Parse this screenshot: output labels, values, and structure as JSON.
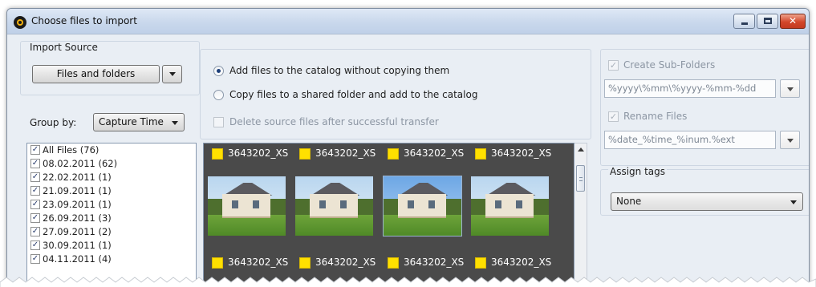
{
  "window": {
    "title": "Choose files to import",
    "close_glyph": "✕"
  },
  "import_source": {
    "group_label": "Import Source",
    "source_button": "Files and folders"
  },
  "group_by": {
    "label": "Group by:",
    "value": "Capture Time"
  },
  "options": {
    "radio_add_without_copy": "Add files to the catalog without copying them",
    "radio_copy_to_shared": "Copy files to a shared folder and add to the catalog",
    "delete_source_label": "Delete source files after successful transfer",
    "selected_radio": "add_without_copy"
  },
  "file_groups": [
    {
      "label": "All Files (76)",
      "checked": true
    },
    {
      "label": "08.02.2011 (62)",
      "checked": true
    },
    {
      "label": "22.02.2011 (1)",
      "checked": true
    },
    {
      "label": "21.09.2011 (1)",
      "checked": true
    },
    {
      "label": "23.09.2011 (1)",
      "checked": true
    },
    {
      "label": "26.09.2011 (3)",
      "checked": true
    },
    {
      "label": "27.09.2011 (2)",
      "checked": true
    },
    {
      "label": "30.09.2011 (1)",
      "checked": true
    },
    {
      "label": "04.11.2011 (4)",
      "checked": true
    }
  ],
  "thumbnails": {
    "row1": [
      "3643202_XS",
      "3643202_XS",
      "3643202_XS",
      "3643202_XS"
    ],
    "row2": [
      "3643202_XS",
      "3643202_XS",
      "3643202_XS",
      "3643202_XS"
    ]
  },
  "right_panel": {
    "create_subfolders_label": "Create Sub-Folders",
    "subfolder_pattern": "%yyyy\\%mm\\%yyyy-%mm-%dd",
    "rename_files_label": "Rename Files",
    "rename_pattern": "%date_%time_%inum.%ext",
    "assign_tags_label": "Assign tags",
    "assign_tags_value": "None"
  },
  "checkmark_glyph": "✓",
  "colors": {
    "window_bg": "#e9eef4",
    "thumb_bg": "#4a4a4a",
    "tag_yellow": "#ffe000",
    "close_red": "#d2472b"
  }
}
